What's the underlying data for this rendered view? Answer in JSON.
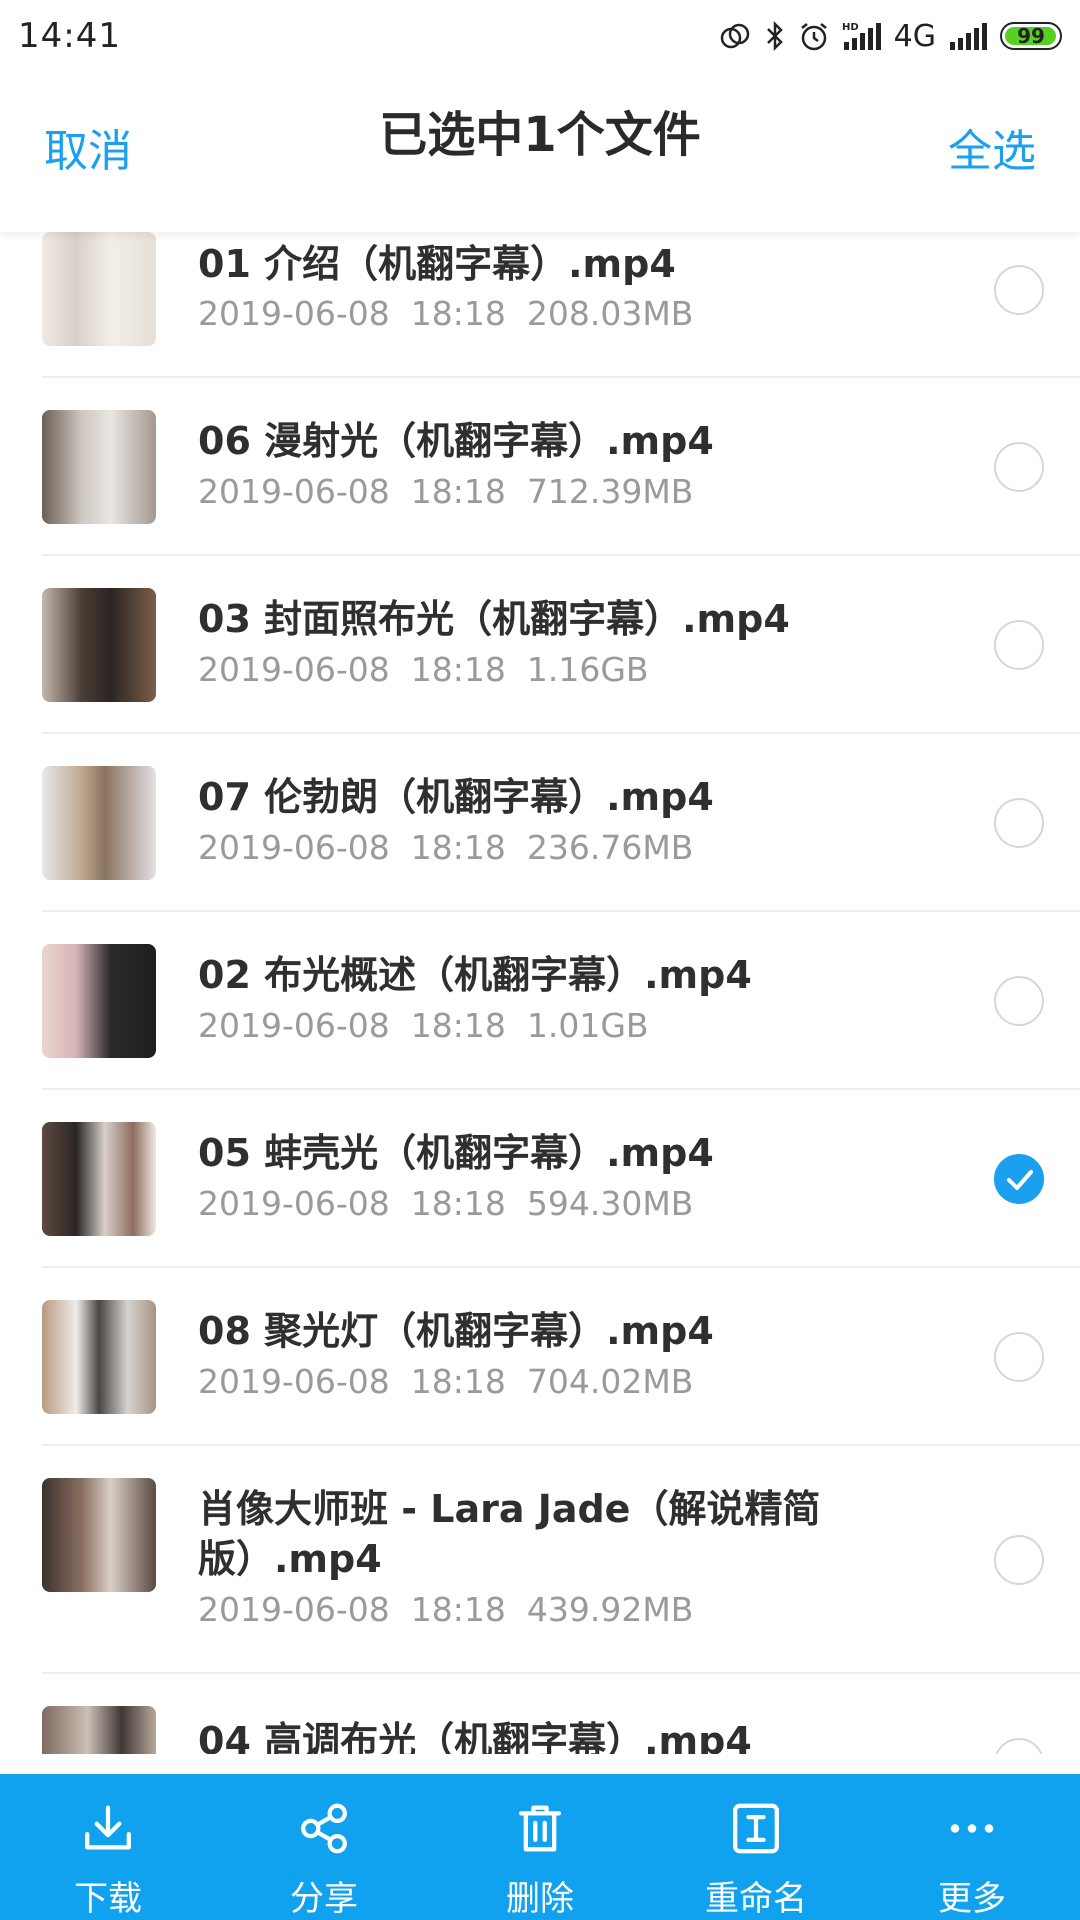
{
  "status_bar": {
    "time": "14:41",
    "network": "4G",
    "battery": "99",
    "battery_level": 0.99,
    "icons": [
      "link-icon",
      "bluetooth-icon",
      "alarm-icon",
      "hd-signal-icon",
      "signal-icon",
      "battery-icon"
    ]
  },
  "header": {
    "cancel": "取消",
    "title": "已选中1个文件",
    "select_all": "全选"
  },
  "files": [
    {
      "name": "01 介绍（机翻字幕）.mp4",
      "date": "2019-06-08",
      "time": "18:18",
      "size": "208.03MB",
      "selected": false
    },
    {
      "name": "06 漫射光（机翻字幕）.mp4",
      "date": "2019-06-08",
      "time": "18:18",
      "size": "712.39MB",
      "selected": false
    },
    {
      "name": "03 封面照布光（机翻字幕）.mp4",
      "date": "2019-06-08",
      "time": "18:18",
      "size": "1.16GB",
      "selected": false
    },
    {
      "name": "07 伦勃朗（机翻字幕）.mp4",
      "date": "2019-06-08",
      "time": "18:18",
      "size": "236.76MB",
      "selected": false
    },
    {
      "name": "02 布光概述（机翻字幕）.mp4",
      "date": "2019-06-08",
      "time": "18:18",
      "size": "1.01GB",
      "selected": false
    },
    {
      "name": "05 蚌壳光（机翻字幕）.mp4",
      "date": "2019-06-08",
      "time": "18:18",
      "size": "594.30MB",
      "selected": true
    },
    {
      "name": "08 聚光灯（机翻字幕）.mp4",
      "date": "2019-06-08",
      "time": "18:18",
      "size": "704.02MB",
      "selected": false
    },
    {
      "name": "肖像大师班 - Lara Jade（解说精简版）.mp4",
      "date": "2019-06-08",
      "time": "18:18",
      "size": "439.92MB",
      "selected": false
    },
    {
      "name": "04 高调布光（机翻字幕）.mp4",
      "date": "",
      "time": "",
      "size": "",
      "selected": false
    }
  ],
  "toolbar": {
    "download": "下载",
    "share": "分享",
    "delete": "删除",
    "rename": "重命名",
    "more": "更多"
  },
  "colors": {
    "accent": "#1ba0f0",
    "toolbar_bg": "#10a2ef",
    "battery": "#58d021"
  }
}
